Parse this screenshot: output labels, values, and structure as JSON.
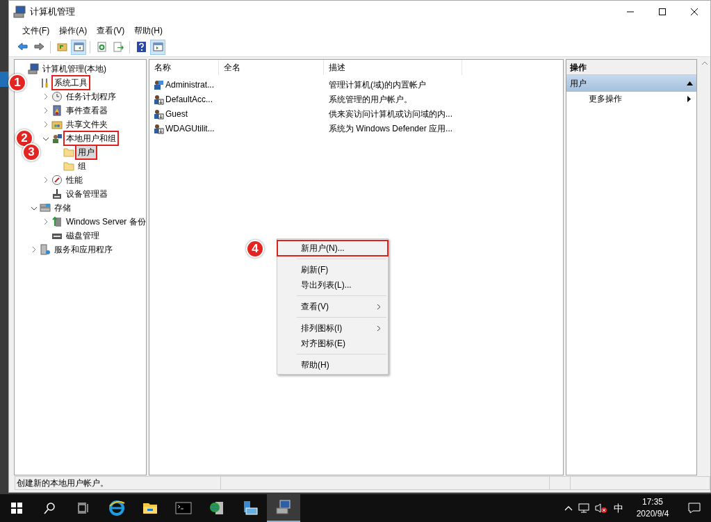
{
  "window": {
    "title": "计算机管理"
  },
  "menu": [
    "文件(F)",
    "操作(A)",
    "查看(V)",
    "帮助(H)"
  ],
  "toolbar": [
    {
      "pressed": false
    },
    {
      "pressed": false
    },
    {
      "pressed": false
    },
    {
      "pressed": true
    },
    {
      "pressed": false
    },
    {
      "pressed": false
    },
    {
      "pressed": false
    },
    {
      "pressed": true
    }
  ],
  "tree": [
    {
      "label": "计算机管理(本地)",
      "has_arrow": false,
      "expanded": true,
      "selected": false,
      "highlighted": false,
      "children": [
        {
          "label": "系统工具",
          "has_arrow": false,
          "expanded": true,
          "selected": false,
          "highlighted": true,
          "badge": "1",
          "children": [
            {
              "label": "任务计划程序",
              "expanded": false,
              "selected": false,
              "highlighted": false
            },
            {
              "label": "事件查看器",
              "expanded": false,
              "selected": false,
              "highlighted": false
            },
            {
              "label": "共享文件夹",
              "expanded": false,
              "selected": false,
              "highlighted": false
            },
            {
              "label": "本地用户和组",
              "expanded": true,
              "selected": false,
              "highlighted": true,
              "badge": "2",
              "children": [
                {
                  "label": "用户",
                  "selected": true,
                  "highlighted": true,
                  "badge": "3"
                },
                {
                  "label": "组",
                  "selected": false,
                  "highlighted": false
                }
              ]
            },
            {
              "label": "性能",
              "expanded": false,
              "selected": false,
              "highlighted": false
            },
            {
              "label": "设备管理器",
              "selected": false,
              "highlighted": false
            }
          ]
        },
        {
          "label": "存储",
          "expanded": true,
          "selected": false,
          "highlighted": false,
          "children": [
            {
              "label": "Windows Server 备份",
              "expanded": false,
              "selected": false,
              "highlighted": false
            },
            {
              "label": "磁盘管理",
              "selected": false,
              "highlighted": false
            }
          ]
        },
        {
          "label": "服务和应用程序",
          "expanded": false,
          "selected": false,
          "highlighted": false
        }
      ]
    }
  ],
  "table": {
    "columns": [
      "名称",
      "全名",
      "描述"
    ],
    "rows": [
      {
        "kind": "admin",
        "cells": [
          "Administrat...",
          "",
          "管理计算机(域)的内置帐户"
        ]
      },
      {
        "kind": "disabled",
        "cells": [
          "DefaultAcc...",
          "",
          "系统管理的用户帐户。"
        ]
      },
      {
        "kind": "disabled",
        "cells": [
          "Guest",
          "",
          "供来宾访问计算机或访问域的内..."
        ]
      },
      {
        "kind": "disabled",
        "cells": [
          "WDAGUtilit...",
          "",
          "系统为 Windows Defender 应用..."
        ]
      }
    ]
  },
  "actions": {
    "title": "操作",
    "section": {
      "label": "用户",
      "expanded": true
    },
    "items": [
      {
        "label": "更多操作"
      }
    ]
  },
  "context_menu": {
    "badge": "4",
    "groups": [
      [
        {
          "label": "新用户(N)...",
          "submenu": false,
          "highlighted": true
        }
      ],
      [
        {
          "label": "刷新(F)",
          "submenu": false,
          "highlighted": false
        },
        {
          "label": "导出列表(L)...",
          "submenu": false,
          "highlighted": false
        }
      ],
      [
        {
          "label": "查看(V)",
          "submenu": true,
          "highlighted": false
        }
      ],
      [
        {
          "label": "排列图标(I)",
          "submenu": true,
          "highlighted": false
        },
        {
          "label": "对齐图标(E)",
          "submenu": false,
          "highlighted": false
        }
      ],
      [
        {
          "label": "帮助(H)",
          "submenu": false,
          "highlighted": false
        }
      ]
    ]
  },
  "status_bar": "创建新的本地用户帐户。",
  "taskbar": {
    "input_method": "中",
    "time": "17:35",
    "date": "2020/9/4",
    "pinned": [
      {
        "active": false
      },
      {
        "active": false
      },
      {
        "active": false
      },
      {
        "active": false
      },
      {
        "active": false
      },
      {
        "active": true
      }
    ]
  }
}
